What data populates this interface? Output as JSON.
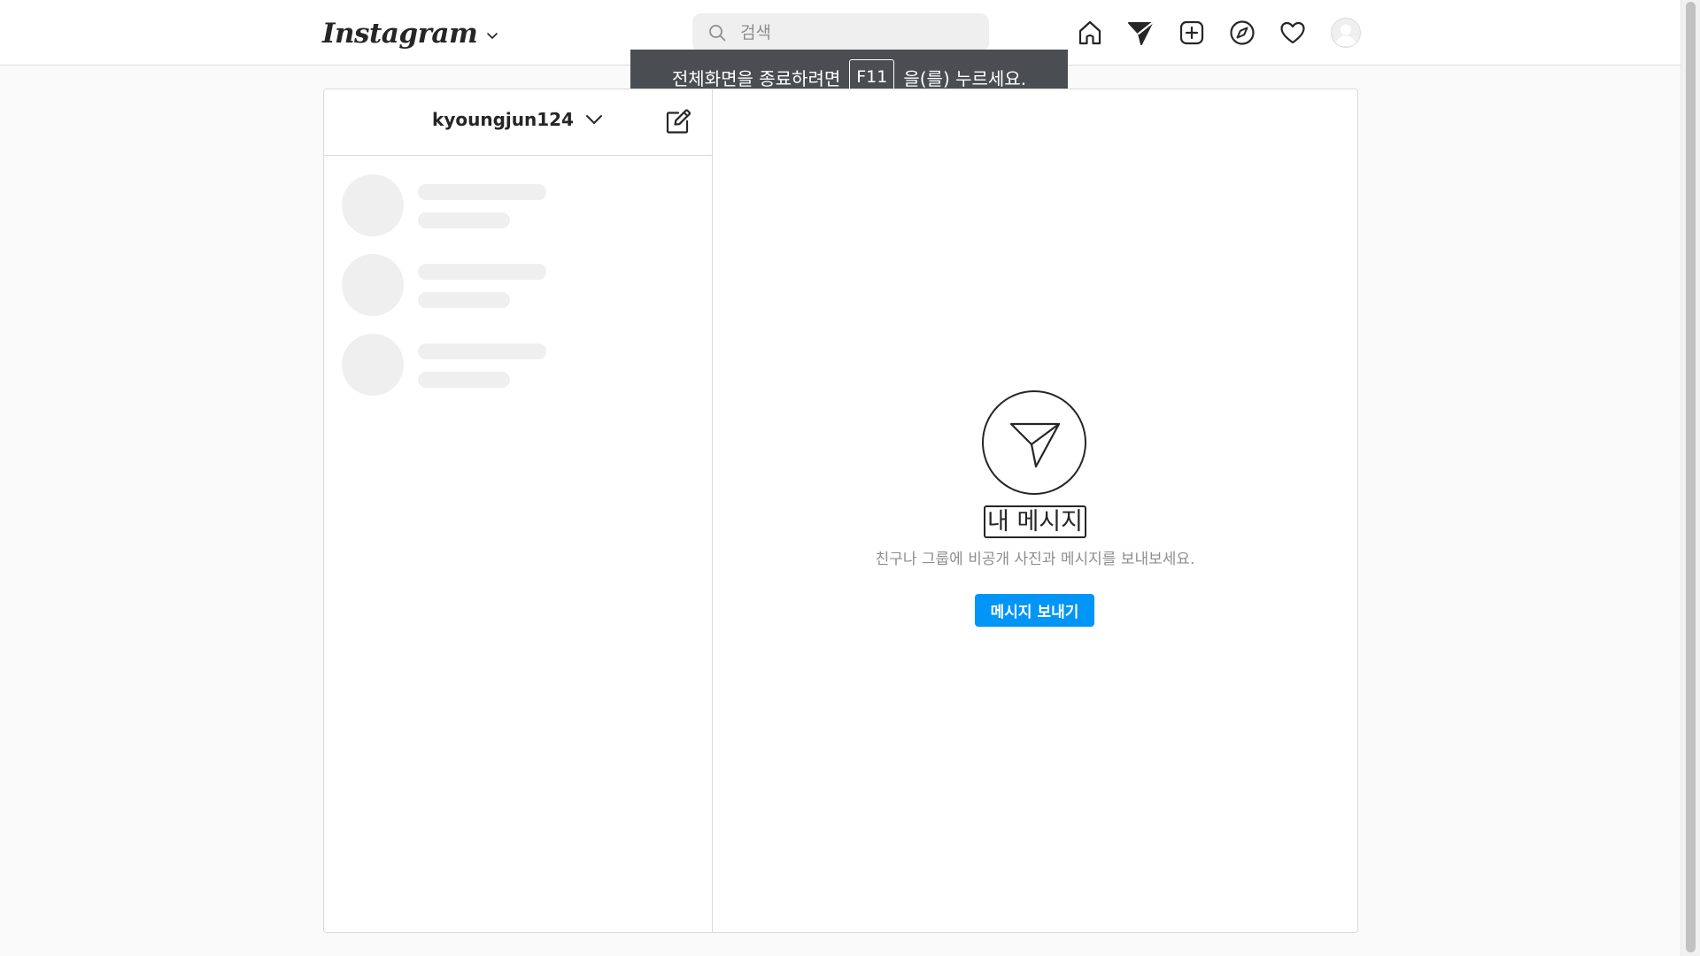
{
  "header": {
    "logo": "Instagram",
    "search": {
      "placeholder": "검색",
      "value": ""
    },
    "nav_icons": [
      "home-icon",
      "direct-message-icon",
      "new-post-icon",
      "explore-icon",
      "activity-heart-icon",
      "profile-avatar"
    ]
  },
  "toast": {
    "prefix": "전체화면을 종료하려면",
    "key": "F11",
    "suffix": "을(를) 누르세요."
  },
  "inbox": {
    "account_name": "kyoungjun124",
    "conversations_loading": 3
  },
  "empty_state": {
    "title": "내 메시지",
    "subtitle": "친구나 그룹에 비공개 사진과 메시지를 보내보세요.",
    "button_label": "메시지 보내기"
  },
  "colors": {
    "accent": "#0095f6",
    "background": "#fafafa",
    "border": "#dbdbdb",
    "text": "#262626",
    "muted_text": "#8e8e8e",
    "skeleton": "#efefef",
    "toast_bg": "#4a4d52"
  }
}
